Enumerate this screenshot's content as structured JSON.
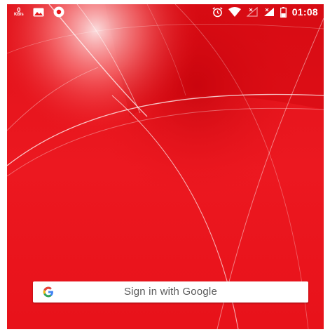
{
  "status_bar": {
    "net_speed_value": "0",
    "net_speed_unit": "KB/s",
    "time": "01:08",
    "left_icons": [
      "network-speed-icon",
      "image-notification-icon",
      "record-notification-icon"
    ],
    "right_icons": [
      "alarm-icon",
      "wifi-icon",
      "signal-sim1-icon",
      "signal-sim2-icon",
      "battery-icon"
    ]
  },
  "signin": {
    "label": "Sign in with Google",
    "icon": "google-logo-icon"
  },
  "colors": {
    "background": "#e8141b",
    "button_bg": "#ffffff",
    "button_text": "#5a5a5a",
    "status_text": "#ffffff"
  }
}
